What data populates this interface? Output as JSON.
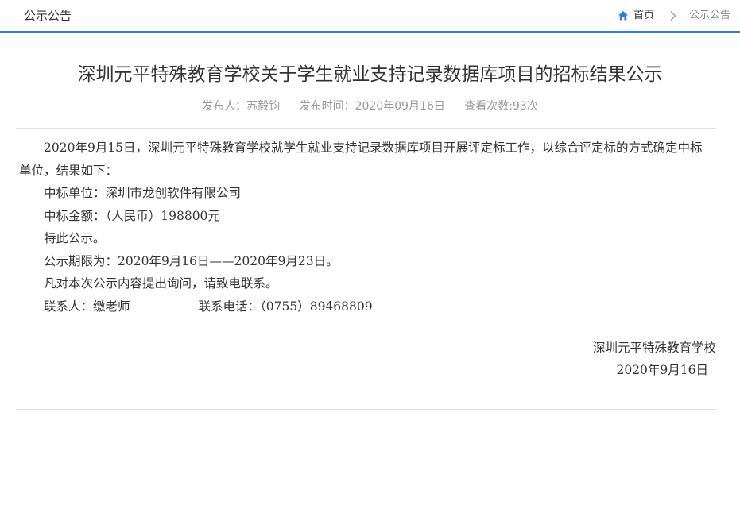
{
  "header": {
    "title": "公示公告",
    "breadcrumb": {
      "home": "首页",
      "current": "公示公告"
    }
  },
  "article": {
    "title": "深圳元平特殊教育学校关于学生就业支持记录数据库项目的招标结果公示",
    "meta": {
      "publisher": "发布人：苏毅钧",
      "publish_time": "发布时间：2020年09月16日",
      "views": "查看次数:93次"
    },
    "paragraphs": [
      "2020年9月15日，深圳元平特殊教育学校就学生就业支持记录数据库项目开展评定标工作，以综合评定标的方式确定中标单位，结果如下：",
      "中标单位：深圳市龙创软件有限公司",
      "中标金额：（人民币）198800元",
      "特此公示。",
      "公示期限为：2020年9月16日——2020年9月23日。",
      "凡对本次公示内容提出询问，请致电联系。"
    ],
    "contact": {
      "person": "联系人：缴老师",
      "phone": "联系电话：（0755）89468809"
    },
    "signature": {
      "org": "深圳元平特殊教育学校",
      "date": "2020年9月16日"
    }
  },
  "colors": {
    "accent": "#2b7de1",
    "text": "#333333",
    "meta_text": "#999999",
    "divider": "#e2e2e2"
  },
  "icons": {
    "home": "home-icon",
    "separator": "chevron-right-icon"
  }
}
